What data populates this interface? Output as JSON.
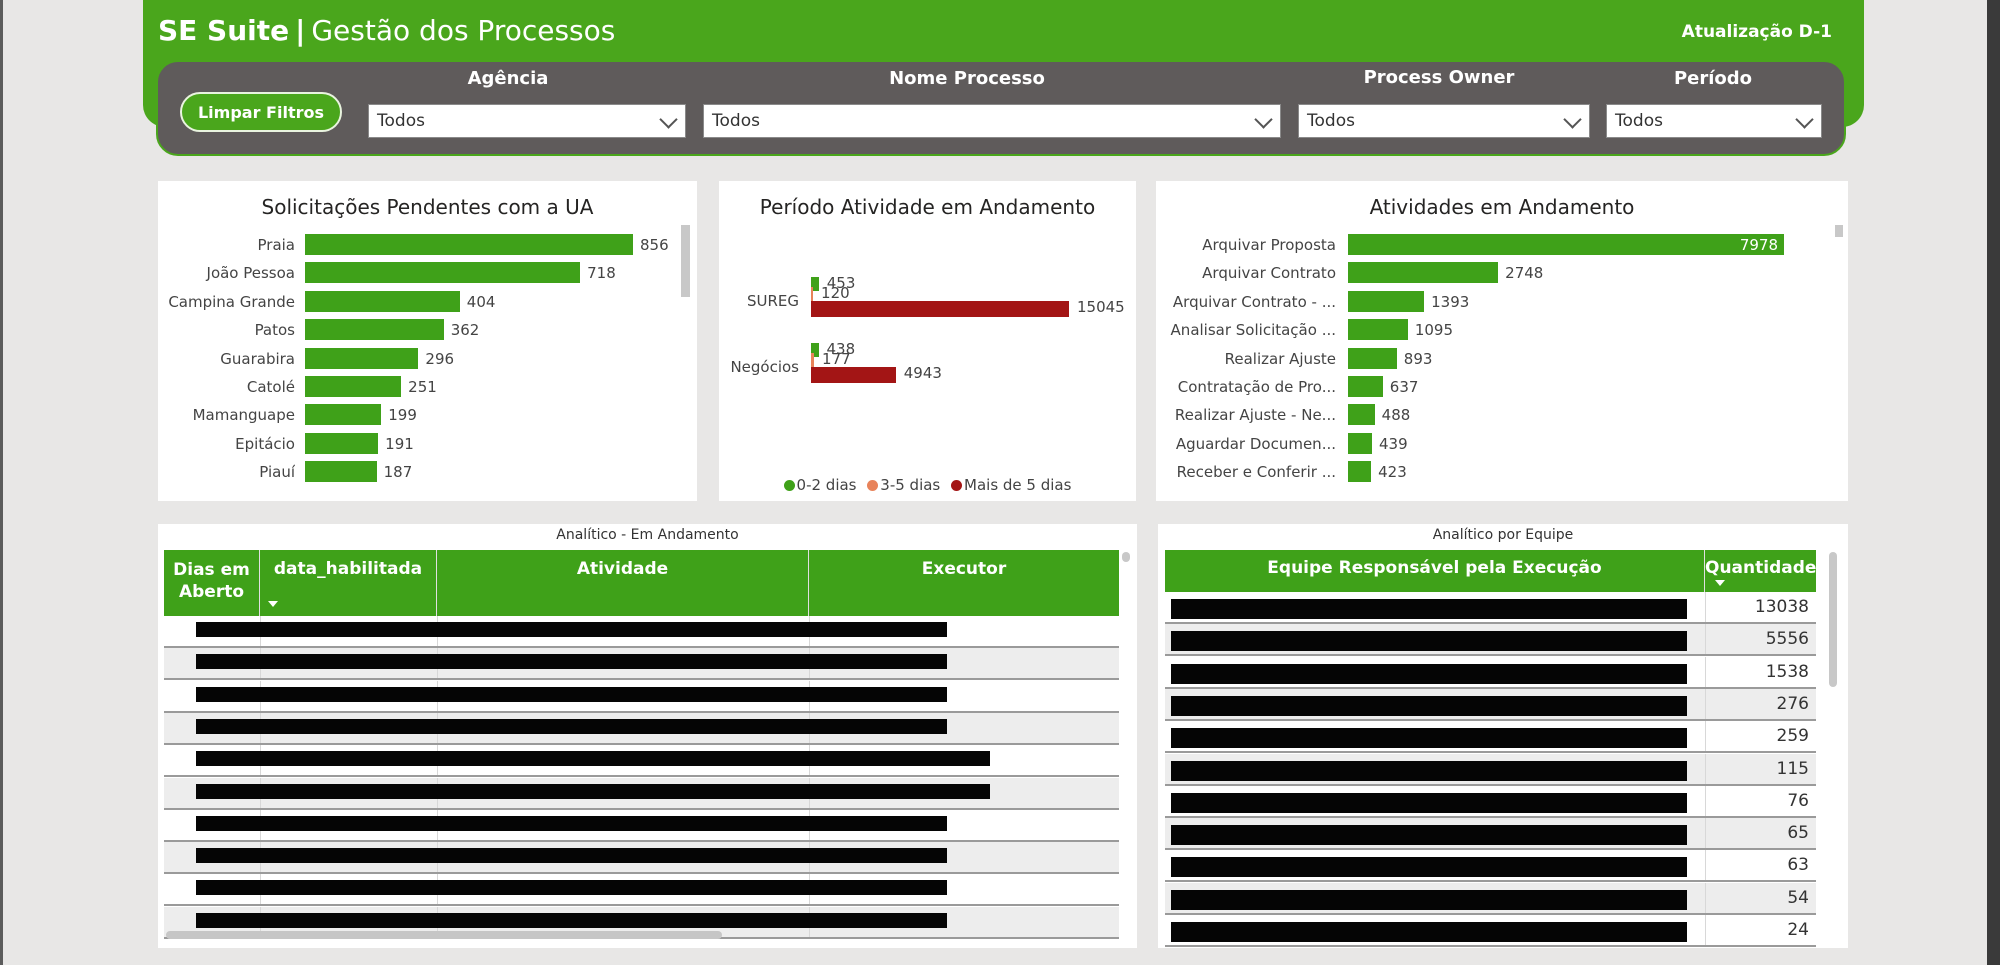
{
  "header": {
    "brand": "SE Suite",
    "separator": "|",
    "subtitle": "Gestão dos Processos",
    "update_label": "Atualização D-1"
  },
  "filters": {
    "clear_label": "Limpar Filtros",
    "agencia": {
      "label": "Agência",
      "value": "Todos"
    },
    "nome_processo": {
      "label": "Nome Processo",
      "value": "Todos"
    },
    "process_owner": {
      "label": "Process Owner",
      "value": "Todos"
    },
    "periodo": {
      "label": "Período",
      "value": "Todos"
    }
  },
  "colors": {
    "green": "#3fa119",
    "dark_red": "#a31515",
    "orange": "#e8835a",
    "filter_bg": "#5f5b5b"
  },
  "chart_data": [
    {
      "type": "bar",
      "orientation": "horizontal",
      "title": "Solicitações Pendentes com a UA",
      "categories": [
        "Praia",
        "João Pessoa",
        "Campina Grande",
        "Patos",
        "Guarabira",
        "Catolé",
        "Mamanguape",
        "Epitácio",
        "Piauí"
      ],
      "values": [
        856,
        718,
        404,
        362,
        296,
        251,
        199,
        191,
        187
      ],
      "xlim": [
        0,
        856
      ],
      "grid": false
    },
    {
      "type": "bar",
      "orientation": "horizontal",
      "title": "Período Atividade em Andamento",
      "categories": [
        "SUREG",
        "Negócios"
      ],
      "series": [
        {
          "name": "0-2 dias",
          "color": "#3fa119",
          "values": [
            453,
            438
          ]
        },
        {
          "name": "3-5 dias",
          "color": "#e8835a",
          "values": [
            120,
            177
          ]
        },
        {
          "name": "Mais de 5 dias",
          "color": "#a31515",
          "values": [
            15045,
            4943
          ]
        }
      ],
      "xlim": [
        0,
        15045
      ],
      "legend": "bottom",
      "grid": false
    },
    {
      "type": "bar",
      "orientation": "horizontal",
      "title": "Atividades em Andamento",
      "categories": [
        "Arquivar Proposta",
        "Arquivar Contrato",
        "Arquivar Contrato - ...",
        "Analisar Solicitação ...",
        "Realizar Ajuste",
        "Contratação de Pro...",
        "Realizar Ajuste - Ne...",
        "Aguardar Documen...",
        "Receber e Conferir ..."
      ],
      "values": [
        7978,
        2748,
        1393,
        1095,
        893,
        637,
        488,
        439,
        423
      ],
      "xlim": [
        0,
        7978
      ],
      "grid": false
    }
  ],
  "analitico": {
    "title": "Analítico - Em Andamento",
    "columns": [
      "Dias em Aberto",
      "data_habilitada",
      "Atividade",
      "Executor"
    ],
    "row_count": 10
  },
  "equipe": {
    "title": "Analítico por Equipe",
    "columns": [
      "Equipe Responsável pela Execução",
      "Quantidade"
    ],
    "quantities": [
      "13038",
      "5556",
      "1538",
      "276",
      "259",
      "115",
      "76",
      "65",
      "63",
      "54",
      "24"
    ]
  }
}
